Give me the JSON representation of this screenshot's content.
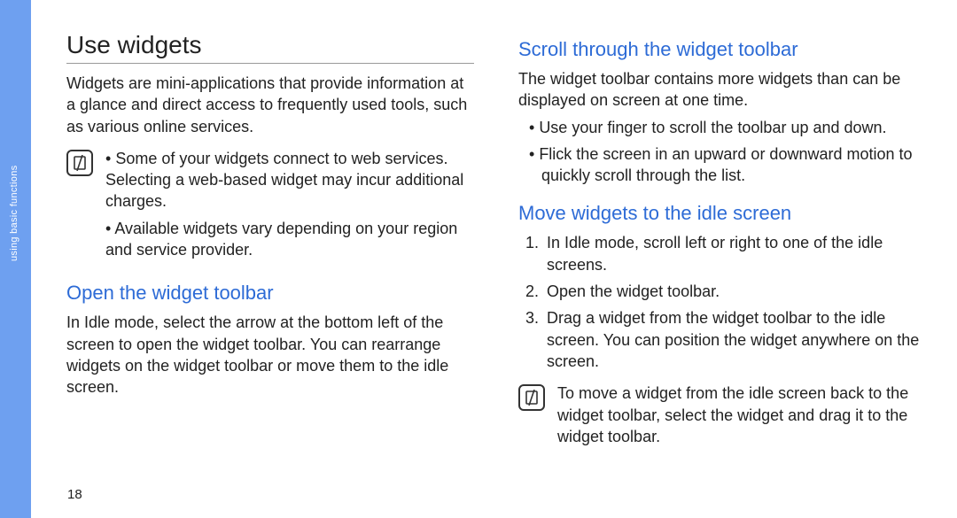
{
  "sidebar": {
    "label": "using basic functions"
  },
  "page_number": "18",
  "left": {
    "title": "Use widgets",
    "intro": "Widgets are mini-applications that provide information at a glance and direct access to frequently used tools, such as various online services.",
    "note1_items": [
      "Some of your widgets connect to web services. Selecting a web-based widget may incur additional charges.",
      "Available widgets vary depending on your region and service provider."
    ],
    "sub1_title": "Open the widget toolbar",
    "sub1_body": "In Idle mode, select the arrow at the bottom left of the screen to open the widget toolbar. You can rearrange widgets on the widget toolbar or move them to the idle screen."
  },
  "right": {
    "sub1_title": "Scroll through the widget toolbar",
    "sub1_body": "The widget toolbar contains more widgets than can be displayed on screen at one time.",
    "sub1_bullets": [
      "Use your finger to scroll the toolbar up and down.",
      " Flick the screen in an upward or downward motion to quickly scroll through the list."
    ],
    "sub2_title": "Move widgets to the idle screen",
    "sub2_steps": [
      "In Idle mode, scroll left or right to one of the idle screens.",
      "Open the widget toolbar.",
      "Drag a widget from the widget toolbar to the idle screen. You can position the widget anywhere on the screen."
    ],
    "note2_text": "To move a widget from the idle screen back to the widget toolbar, select the widget and drag it to the widget toolbar."
  }
}
